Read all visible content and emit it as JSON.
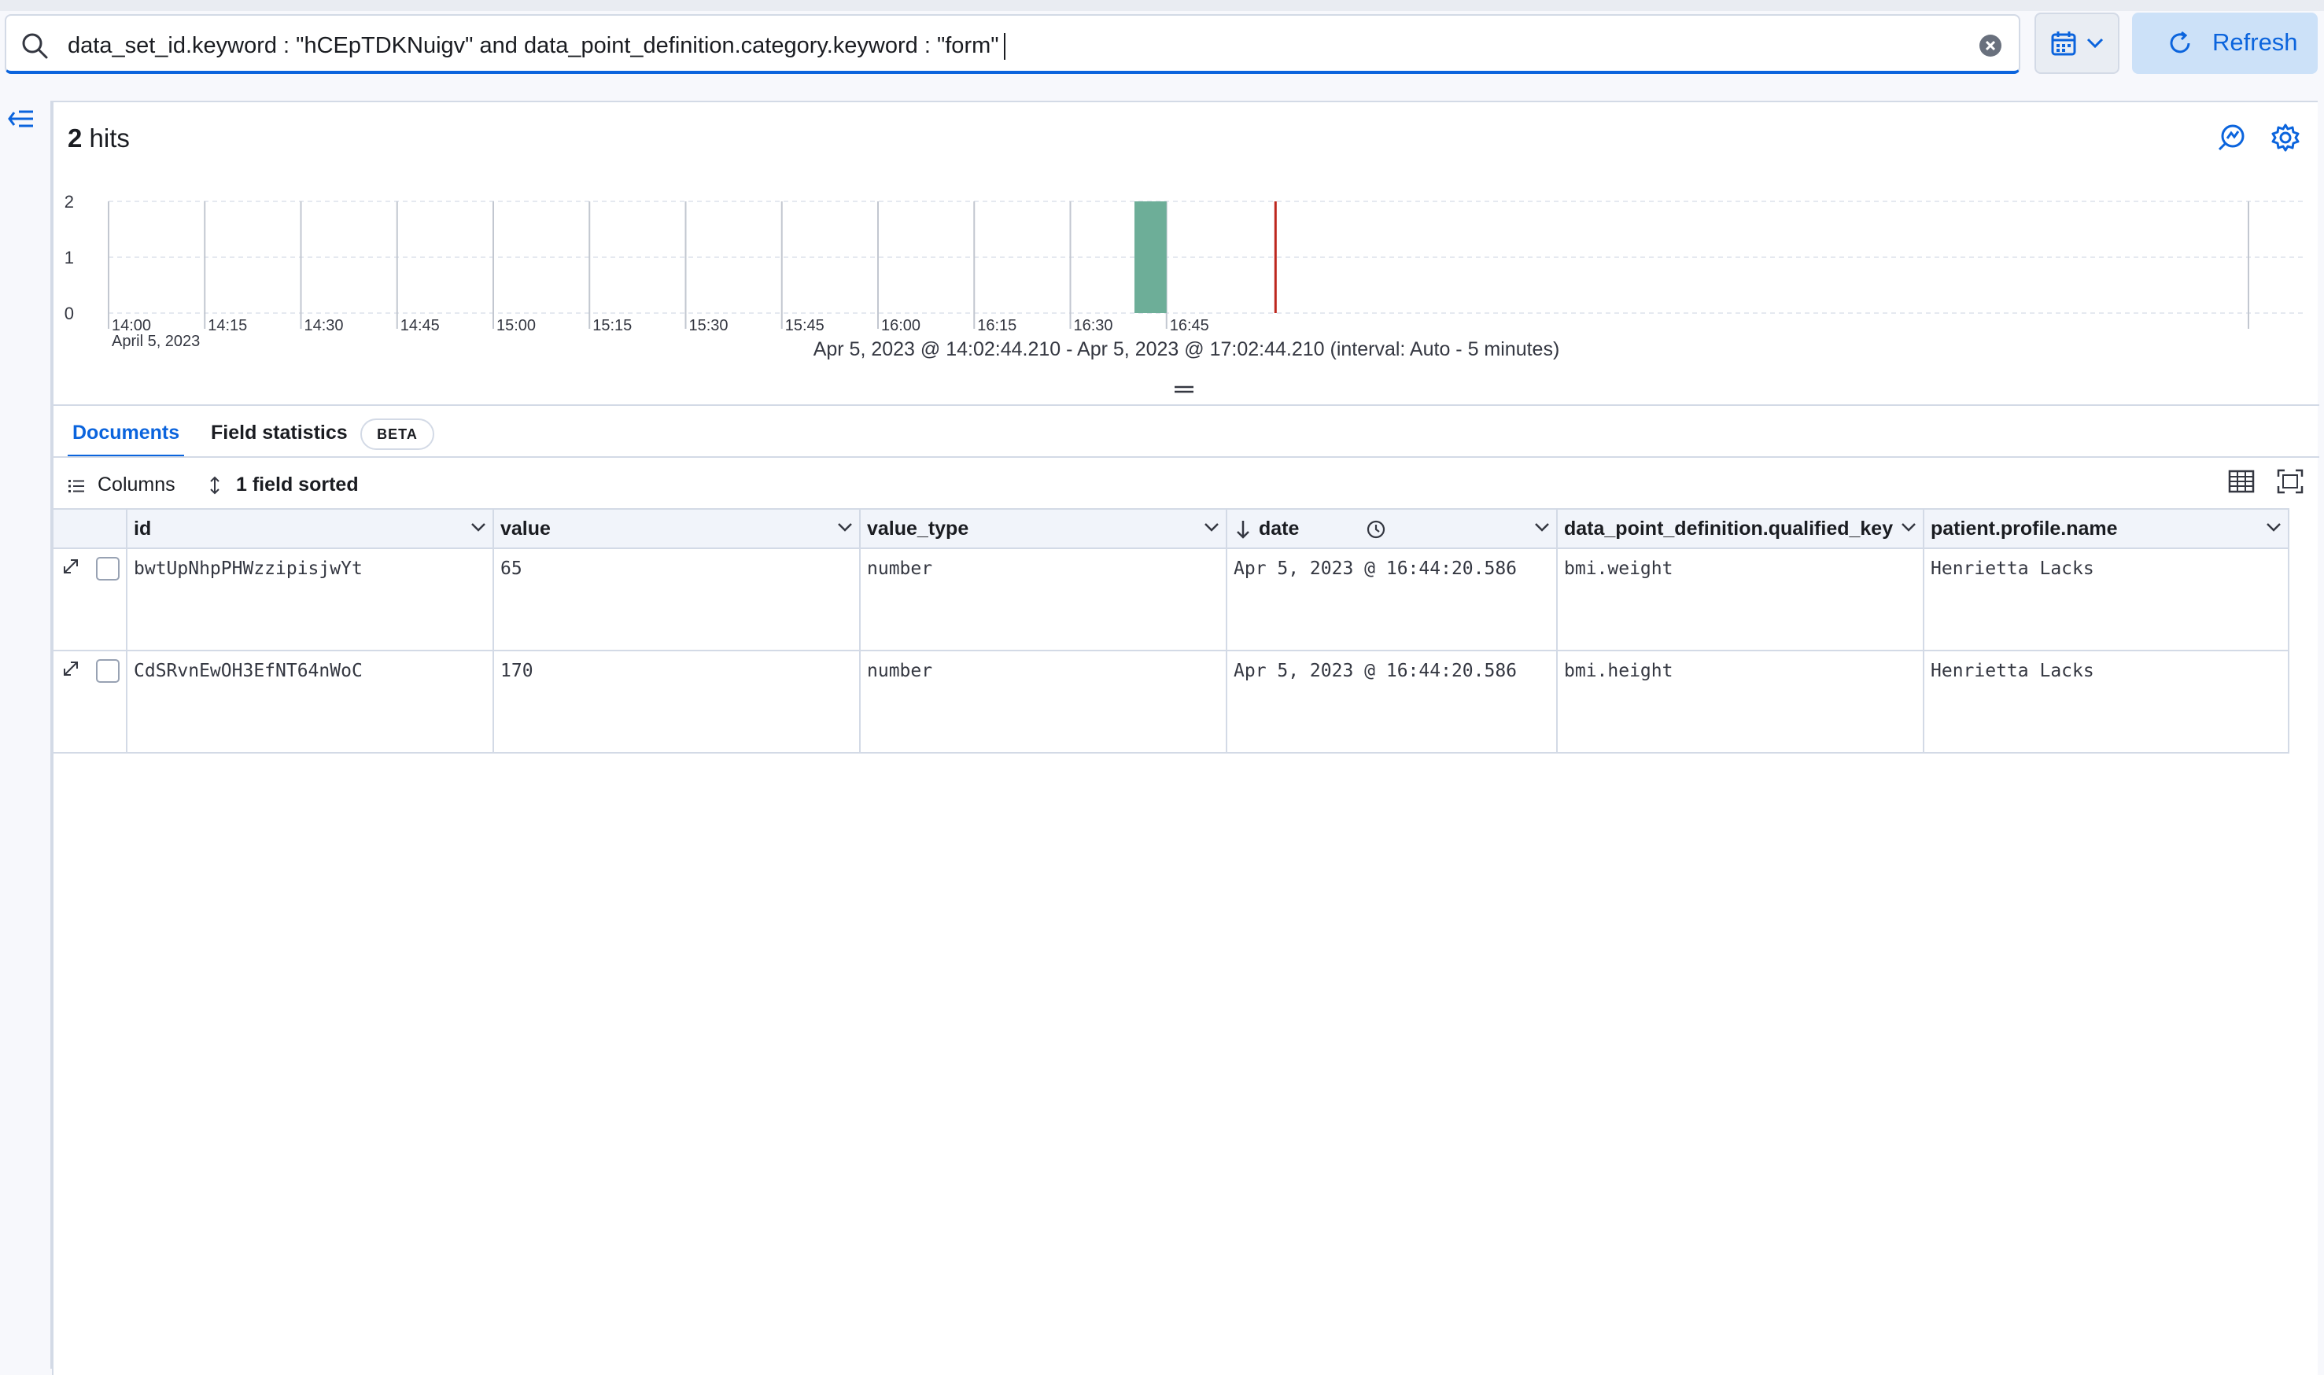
{
  "query": {
    "text": "data_set_id.keyword : \"hCEpTDKNuigv\" and data_point_definition.category.keyword : \"form\""
  },
  "toolbar": {
    "refresh_label": "Refresh"
  },
  "results": {
    "hits_count": "2",
    "hits_label": "hits"
  },
  "chart_data": {
    "type": "bar",
    "x_tick_labels": [
      "14:00",
      "14:15",
      "14:30",
      "14:45",
      "15:00",
      "15:15",
      "15:30",
      "15:45",
      "16:00",
      "16:15",
      "16:30",
      "16:45"
    ],
    "x_date_label": "April 5, 2023",
    "y_ticks": [
      0,
      1,
      2
    ],
    "ylim": [
      0,
      2
    ],
    "xlim": [
      "14:00",
      "17:02"
    ],
    "bars": [
      {
        "x": "16:40",
        "width_minutes": 5,
        "value": 2
      }
    ],
    "now_marker": "17:02",
    "bar_color": "#6dae98",
    "marker_color": "#bd271e",
    "grid": true
  },
  "time_range_text": "Apr 5, 2023 @ 14:02:44.210 - Apr 5, 2023 @ 17:02:44.210 (interval: Auto - 5 minutes)",
  "tabs": {
    "documents": "Documents",
    "field_statistics": "Field statistics",
    "beta_badge": "BETA"
  },
  "grid_toolbar": {
    "columns_label": "Columns",
    "sorted_label": "1 field sorted"
  },
  "columns": [
    "id",
    "value",
    "value_type",
    "date",
    "data_point_definition.qualified_key",
    "patient.profile.name"
  ],
  "rows": [
    [
      "bwtUpNhpPHWzzipisjwYt",
      "65",
      "number",
      "Apr 5, 2023 @ 16:44:20.586",
      "bmi.weight",
      "Henrietta Lacks"
    ],
    [
      "CdSRvnEwOH3EfNT64nWoC",
      "170",
      "number",
      "Apr 5, 2023 @ 16:44:20.586",
      "bmi.height",
      "Henrietta Lacks"
    ]
  ],
  "icons": {
    "search": "search-icon",
    "clear": "clear-icon",
    "calendar": "calendar-icon",
    "refresh": "refresh-icon",
    "collapse": "collapse-sidebar-icon",
    "inspect": "inspect-icon",
    "settings": "gear-icon",
    "columns": "list-icon",
    "sort": "sort-icon",
    "density": "density-icon",
    "fullscreen": "fullscreen-icon",
    "expand_row": "expand-icon",
    "sort_desc": "arrow-down-icon",
    "clock": "clock-icon"
  }
}
